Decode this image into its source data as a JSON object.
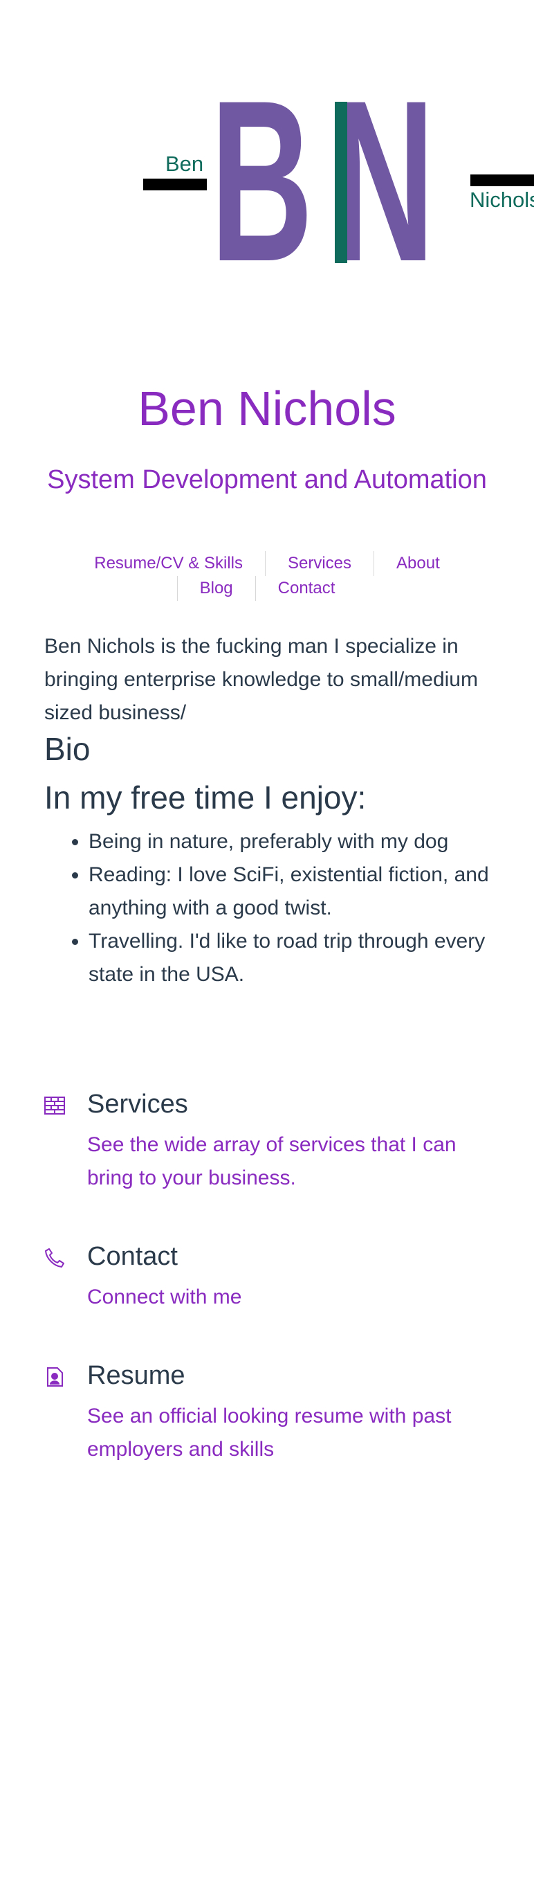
{
  "logo": {
    "left_name": "Ben",
    "right_name": "Nichols",
    "letters": "BN",
    "colors": {
      "letters": "#7158a2",
      "accent": "#0f6b5b",
      "bar": "#000000",
      "names": "#0f6b5b"
    }
  },
  "header": {
    "title": "Ben Nichols",
    "tagline": "System Development and Automation"
  },
  "nav": {
    "items": [
      {
        "label": "Resume/CV & Skills"
      },
      {
        "label": "Services"
      },
      {
        "label": "About"
      },
      {
        "label": "Blog"
      },
      {
        "label": "Contact"
      }
    ]
  },
  "main": {
    "intro": "Ben Nichols is the fucking man I specialize in bringing enterprise knowledge to small/medium sized business/",
    "bio_heading": "Bio",
    "free_time_heading": "In my free time I enjoy:",
    "hobbies": [
      "Being in nature, preferably with my dog",
      "Reading: I love SciFi, existential fiction, and anything with a good twist.",
      "Travelling. I'd like to road trip through every state in the USA."
    ]
  },
  "cards": [
    {
      "title": "Services",
      "description": "See the wide array of services that I can bring to your business.",
      "icon": "brick-wall-icon"
    },
    {
      "title": "Contact",
      "description": "Connect with me",
      "icon": "phone-icon"
    },
    {
      "title": "Resume",
      "description": "See an official looking resume with past employers and skills",
      "icon": "resume-document-icon"
    }
  ],
  "colors": {
    "accent": "#8a2bc0",
    "text": "#2b3a4a",
    "background": "#ffffff"
  }
}
